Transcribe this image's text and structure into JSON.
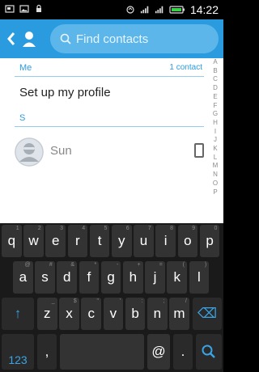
{
  "status_bar": {
    "time": "14:22"
  },
  "header": {
    "search_placeholder": "Find contacts"
  },
  "list": {
    "me_header": "Me",
    "me_count": "1 contact",
    "setup_profile": "Set up my profile",
    "section_letter": "S",
    "contact_name": "Sun",
    "index_letters": [
      "A",
      "B",
      "C",
      "D",
      "E",
      "F",
      "G",
      "H",
      "I",
      "J",
      "K",
      "L",
      "M",
      "N",
      "O",
      "P"
    ]
  },
  "keyboard": {
    "row1": [
      {
        "k": "q",
        "h": "1"
      },
      {
        "k": "w",
        "h": "2"
      },
      {
        "k": "e",
        "h": "3"
      },
      {
        "k": "r",
        "h": "4"
      },
      {
        "k": "t",
        "h": "5"
      },
      {
        "k": "y",
        "h": "6"
      },
      {
        "k": "u",
        "h": "7"
      },
      {
        "k": "i",
        "h": "8"
      },
      {
        "k": "o",
        "h": "9"
      },
      {
        "k": "p",
        "h": "0"
      }
    ],
    "row2": [
      {
        "k": "a",
        "h": "@"
      },
      {
        "k": "s",
        "h": "#"
      },
      {
        "k": "d",
        "h": "&"
      },
      {
        "k": "f",
        "h": "*"
      },
      {
        "k": "g",
        "h": "-"
      },
      {
        "k": "h",
        "h": "+"
      },
      {
        "k": "j",
        "h": "="
      },
      {
        "k": "k",
        "h": "("
      },
      {
        "k": "l",
        "h": ")"
      }
    ],
    "row3": [
      {
        "k": "z",
        "h": "_"
      },
      {
        "k": "x",
        "h": "$"
      },
      {
        "k": "c",
        "h": "\""
      },
      {
        "k": "v",
        "h": "'"
      },
      {
        "k": "b",
        "h": ":"
      },
      {
        "k": "n",
        "h": ";"
      },
      {
        "k": "m",
        "h": "/"
      }
    ],
    "shift_label": "↑",
    "numbers_label": "123",
    "comma_label": ",",
    "at_label": "@",
    "backspace_label": "⌫",
    "search_label": "search"
  },
  "colors": {
    "accent": "#2b9be0",
    "keyboard_bg": "#1a1a1a",
    "key_bg": "#333333"
  }
}
